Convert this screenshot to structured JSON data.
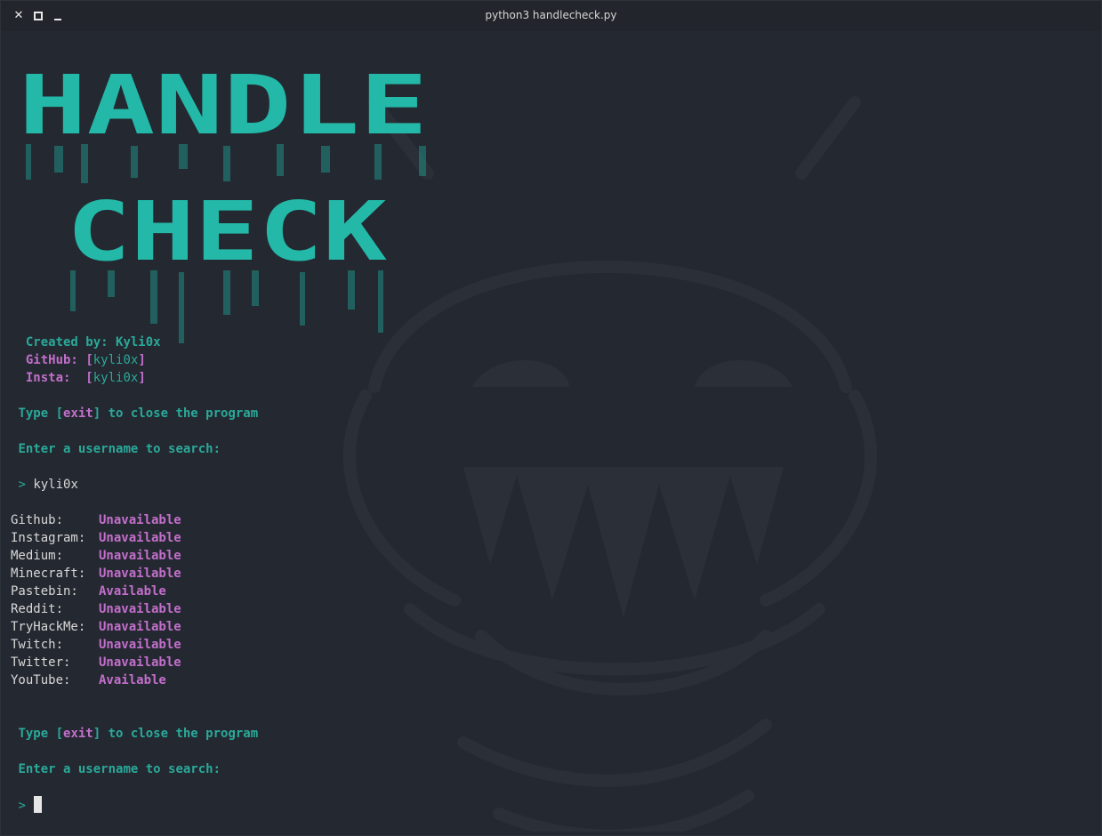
{
  "window": {
    "title": "python3 handlecheck.py"
  },
  "banner": {
    "line1": "HANDLE",
    "line2": "CHECK"
  },
  "credits": {
    "created_label": "Created by:",
    "created_value": "Kyli0x",
    "github_label": "GitHub:",
    "github_value": "kyli0x",
    "insta_label": "Insta:",
    "insta_value": "kyli0x"
  },
  "prompt1": {
    "type_pre": "Type",
    "exit_word": "exit",
    "type_post": "to close the program",
    "enter_text": "Enter a username to search:",
    "caret": ">",
    "input_value": "kyli0x"
  },
  "results": [
    {
      "site": "Github:",
      "status": "Unavailable"
    },
    {
      "site": "Instagram:",
      "status": "Unavailable"
    },
    {
      "site": "Medium:",
      "status": "Unavailable"
    },
    {
      "site": "Minecraft:",
      "status": "Unavailable"
    },
    {
      "site": "Pastebin:",
      "status": "Available"
    },
    {
      "site": "Reddit:",
      "status": "Unavailable"
    },
    {
      "site": "TryHackMe:",
      "status": "Unavailable"
    },
    {
      "site": "Twitch:",
      "status": "Unavailable"
    },
    {
      "site": "Twitter:",
      "status": "Unavailable"
    },
    {
      "site": "YouTube:",
      "status": "Available"
    }
  ],
  "prompt2": {
    "type_pre": "Type",
    "exit_word": "exit",
    "type_post": "to close the program",
    "enter_text": "Enter a username to search:",
    "caret": ">",
    "input_value": ""
  },
  "colors": {
    "accent": "#2aa99a",
    "highlight": "#c26fcb",
    "background": "#242830"
  }
}
